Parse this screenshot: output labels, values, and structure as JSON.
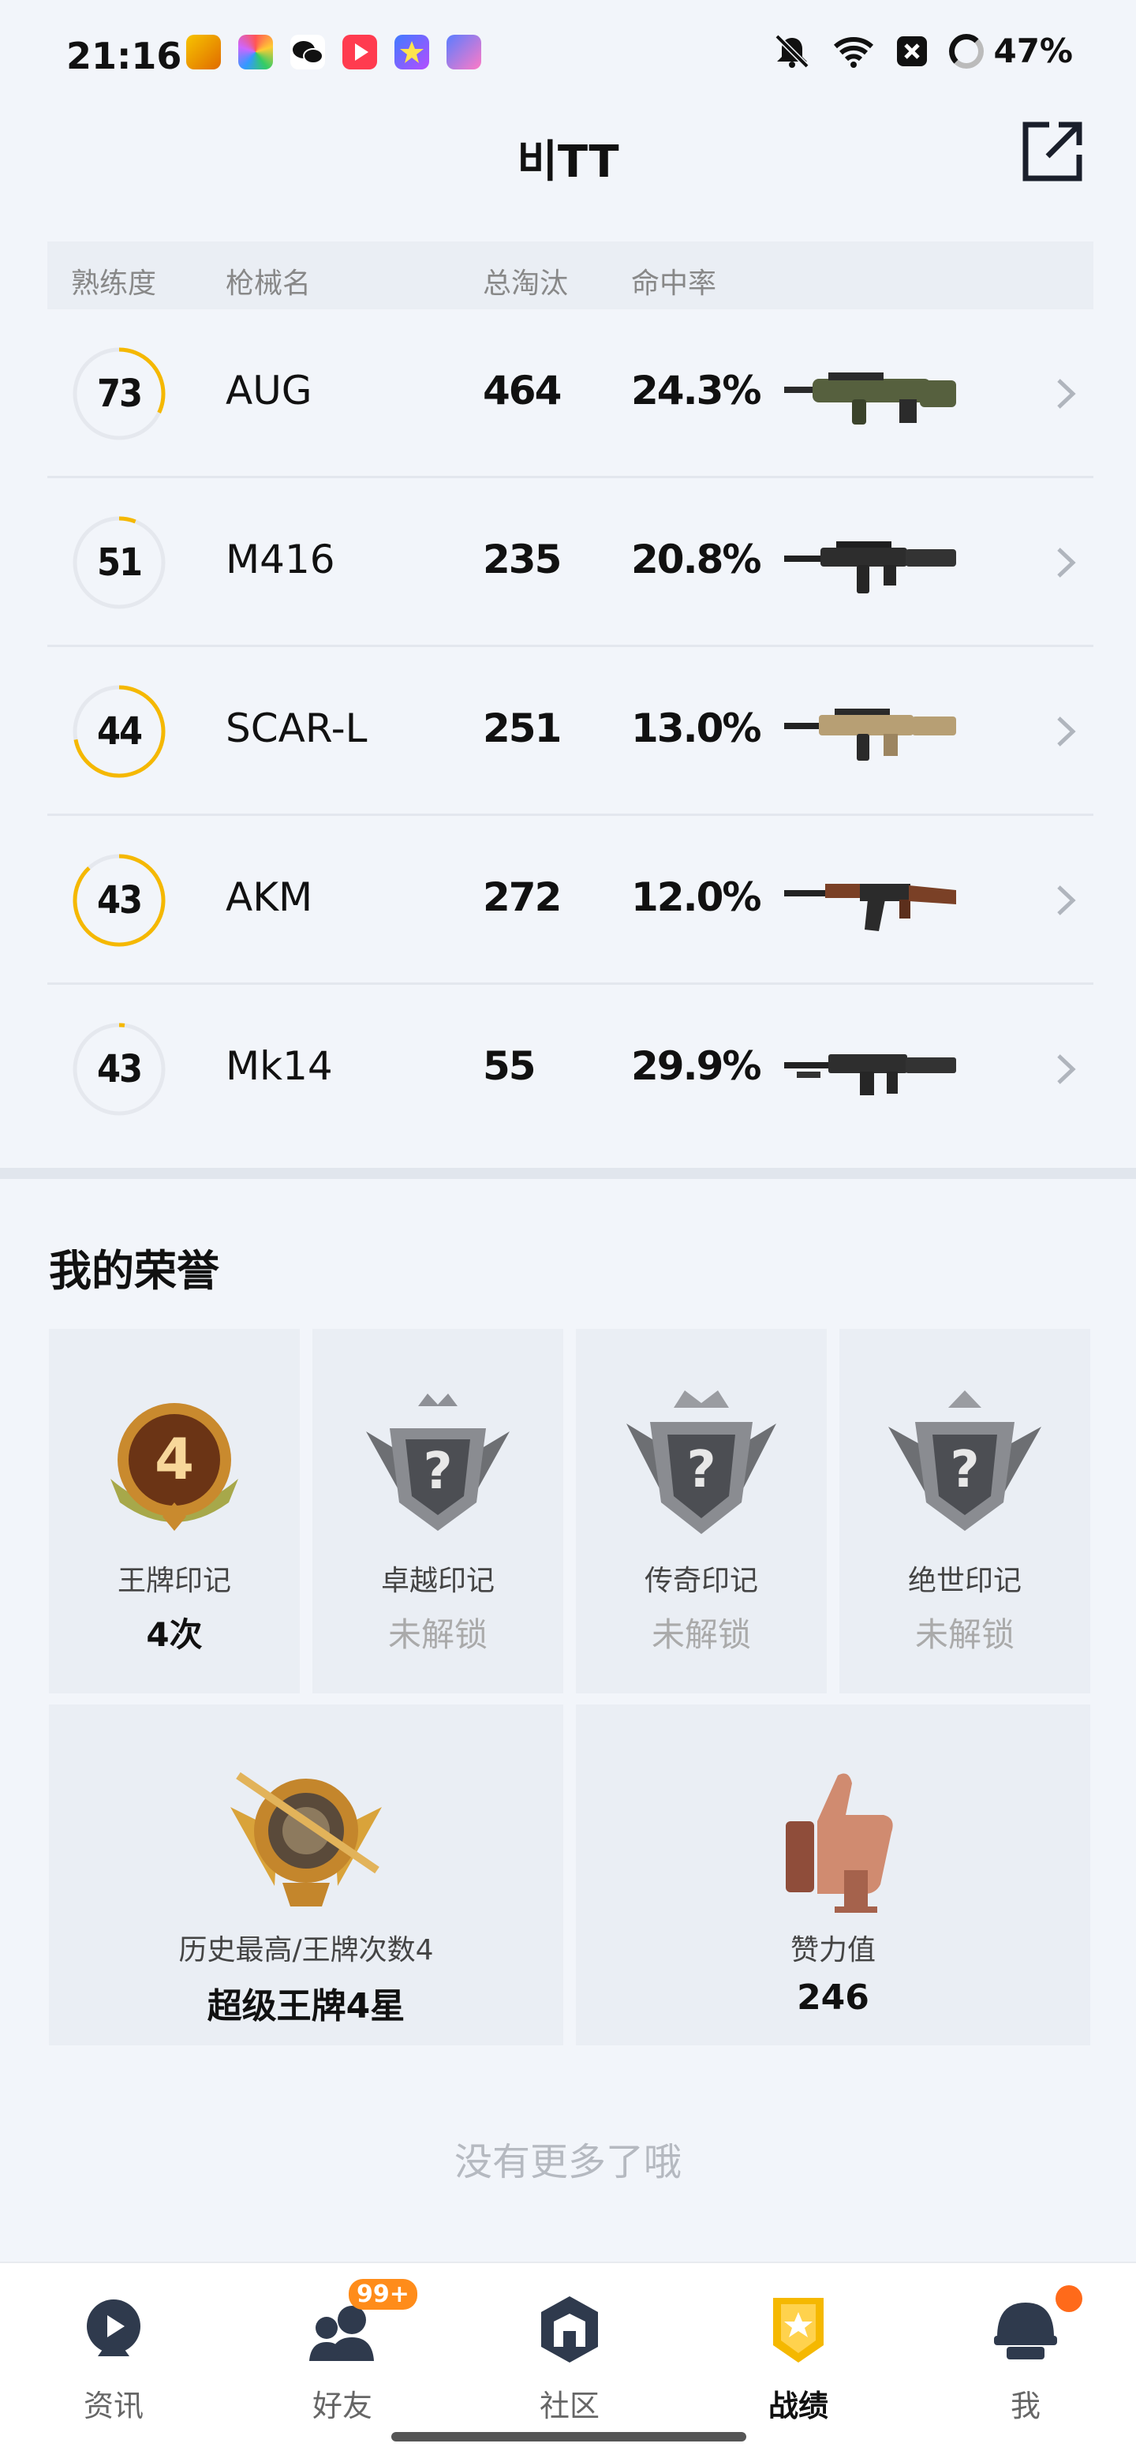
{
  "status_bar": {
    "time": "21:16",
    "battery": "47%"
  },
  "header": {
    "title": "비TT"
  },
  "table": {
    "headers": {
      "mastery": "熟练度",
      "gun_name": "枪械名",
      "kills": "总淘汰",
      "accuracy": "命中率"
    },
    "rows": [
      {
        "mastery": "73",
        "mastery_fraction": 0.32,
        "name": "AUG",
        "kills": "464",
        "accuracy": "24.3%",
        "gun_icon": "aug-rifle"
      },
      {
        "mastery": "51",
        "mastery_fraction": 0.06,
        "name": "M416",
        "kills": "235",
        "accuracy": "20.8%",
        "gun_icon": "m416-rifle"
      },
      {
        "mastery": "44",
        "mastery_fraction": 0.72,
        "name": "SCAR-L",
        "kills": "251",
        "accuracy": "13.0%",
        "gun_icon": "scar-l-rifle"
      },
      {
        "mastery": "43",
        "mastery_fraction": 0.88,
        "name": "AKM",
        "kills": "272",
        "accuracy": "12.0%",
        "gun_icon": "akm-rifle"
      },
      {
        "mastery": "43",
        "mastery_fraction": 0.02,
        "name": "Mk14",
        "kills": "55",
        "accuracy": "29.9%",
        "gun_icon": "mk14-rifle"
      }
    ]
  },
  "honor": {
    "title": "我的荣誉",
    "badges": [
      {
        "name": "王牌印记",
        "value": "4次",
        "locked": false,
        "badge_number": "4"
      },
      {
        "name": "卓越印记",
        "value": "未解锁",
        "locked": true,
        "badge_number": "?"
      },
      {
        "name": "传奇印记",
        "value": "未解锁",
        "locked": true,
        "badge_number": "?"
      },
      {
        "name": "绝世印记",
        "value": "未解锁",
        "locked": true,
        "badge_number": "?"
      }
    ],
    "highest": {
      "label": "历史最高/王牌次数4",
      "value": "超级王牌4星"
    },
    "likes": {
      "label": "赞力值",
      "value": "246"
    }
  },
  "footer_text": "没有更多了哦",
  "nav": {
    "items": [
      {
        "label": "资讯",
        "icon": "news-icon",
        "active": false
      },
      {
        "label": "好友",
        "icon": "friends-icon",
        "active": false,
        "badge": "99+"
      },
      {
        "label": "社区",
        "icon": "community-icon",
        "active": false
      },
      {
        "label": "战绩",
        "icon": "stats-icon",
        "active": true
      },
      {
        "label": "我",
        "icon": "profile-icon",
        "active": false
      }
    ]
  },
  "colors": {
    "accent": "#f5b800",
    "ring_track": "#e5e8ee",
    "locked_text": "#aaaaaa"
  }
}
